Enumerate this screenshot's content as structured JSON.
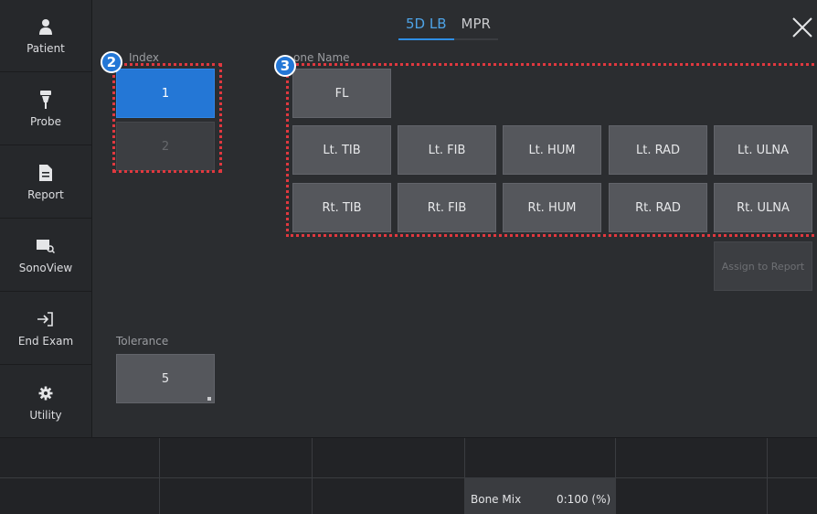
{
  "sidebar": {
    "items": [
      {
        "label": "Patient",
        "icon": "person-icon"
      },
      {
        "label": "Probe",
        "icon": "probe-icon"
      },
      {
        "label": "Report",
        "icon": "report-icon"
      },
      {
        "label": "SonoView",
        "icon": "sonoview-icon"
      },
      {
        "label": "End Exam",
        "icon": "end-exam-icon"
      },
      {
        "label": "Utility",
        "icon": "gear-icon"
      }
    ]
  },
  "tabs": [
    {
      "label": "5D LB",
      "active": true
    },
    {
      "label": "MPR",
      "active": false
    }
  ],
  "index": {
    "label": "Index",
    "badge": "2",
    "options": [
      {
        "label": "1",
        "selected": true
      },
      {
        "label": "2",
        "selected": false
      }
    ]
  },
  "bone": {
    "label": "one Name",
    "badge": "3",
    "fl": "FL",
    "row1": [
      "Lt. TIB",
      "Lt. FIB",
      "Lt. HUM",
      "Lt. RAD",
      "Lt. ULNA"
    ],
    "row2": [
      "Rt. TIB",
      "Rt. FIB",
      "Rt. HUM",
      "Rt. RAD",
      "Rt. ULNA"
    ],
    "assign": "Assign to Report"
  },
  "tolerance": {
    "label": "Tolerance",
    "value": "5"
  },
  "bottom": {
    "bone_mix_label": "Bone Mix",
    "bone_mix_value": "0:100 (%)"
  },
  "colors": {
    "accent": "#2477d6",
    "annotation": "#e0383f"
  }
}
